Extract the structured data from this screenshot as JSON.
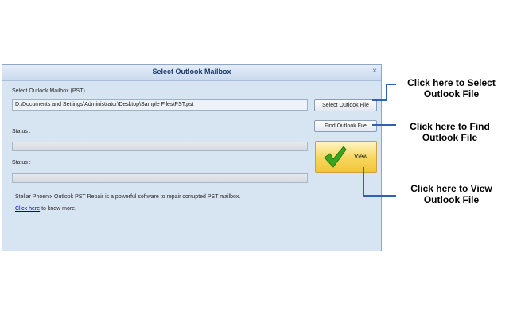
{
  "dialog": {
    "title": "Select Outlook Mailbox",
    "close_glyph": "×",
    "mailbox_label": "Select Outlook Mailbox (PST) :",
    "pst_path": "D:\\Documents and Settings\\Administrator\\Desktop\\Sample Files\\PST.pst",
    "select_button": "Select Outlook File",
    "find_button": "Find Outlook File",
    "status_label_1": "Status :",
    "status_label_2": "Status :",
    "progress_1": 0,
    "progress_2": 0,
    "view_button": "View",
    "view_icon": "checkmark-icon",
    "description": "Stellar Phoenix Outlook PST Repair is a powerful software to repair corrupted PST mailbox.",
    "link_text": "Click here",
    "link_suffix": " to know more."
  },
  "callouts": {
    "select": [
      "Click here to Select",
      "Outlook File"
    ],
    "find": [
      "Click here to Find",
      "Outlook File"
    ],
    "view": [
      "Click here to View",
      "Outlook File"
    ]
  },
  "colors": {
    "callout_line": "#2e62b7",
    "dialog_bg": "#d7e4f2",
    "view_button": "#f7d55c",
    "checkmark": "#3aa520"
  }
}
